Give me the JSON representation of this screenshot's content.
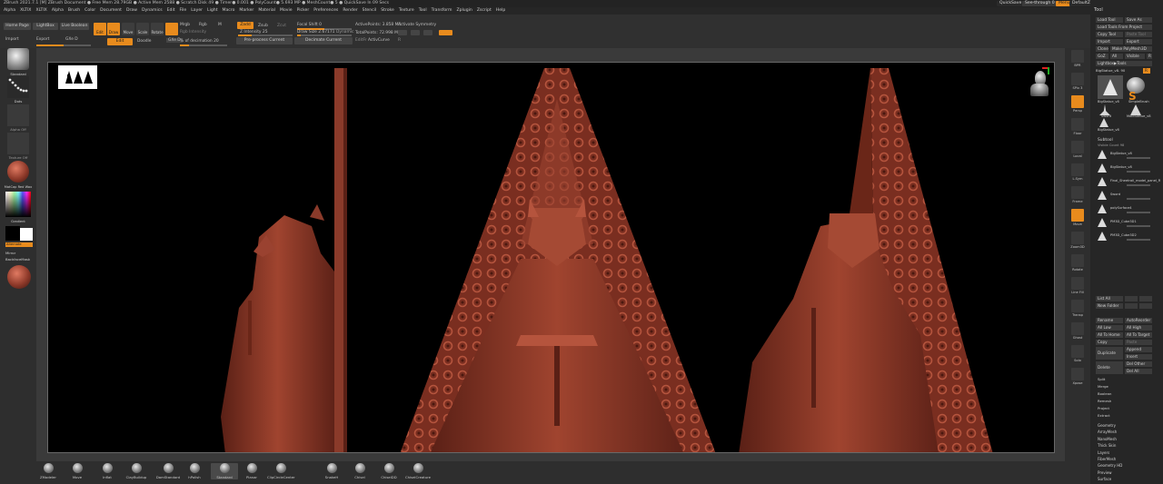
{
  "title_bar": {
    "text": "ZBrush 2021.7.1 [M]   ZBrush Document   ● Free Mem 28.79GB ● Active Mem 2588 ● Scratch Disk 49 ● Timer● 0.001 ● PolyCount● 5.693 MP ● MeshCount● 5 ● QuickSave In 09 Secs",
    "quicksave": "QuickSave",
    "see_through": "See-through 0",
    "menus": "Menus",
    "script": "DefaultZScript"
  },
  "menu_items": [
    "Alpha",
    "Brush",
    "Color",
    "Document",
    "Draw",
    "Dynamics",
    "Edit",
    "File",
    "Layer",
    "Light",
    "Macro",
    "Marker",
    "Material",
    "Movie",
    "Picker",
    "Preferences",
    "Render",
    "Stencil",
    "Stroke",
    "Texture",
    "Tool",
    "Transform",
    "Zplugin",
    "Zscript",
    "Help"
  ],
  "menu_prefix": [
    "Alpha",
    "XLTIX",
    "XLTIX"
  ],
  "shelf": {
    "home_page": "Home Page",
    "lightbox": "LightBox",
    "live_boolean": "Live Boolean",
    "import": "Import",
    "export": "Export",
    "gizmo": "GXe D",
    "edit": "Edit",
    "draw": "Draw",
    "move": "Move",
    "scale": "Scale",
    "rotate": "Rotate",
    "doodle": "Doodle",
    "mrgb": "Mrgb",
    "rgb": "Rgb",
    "m": "M",
    "rgb_intensity": "Rgb Intensity",
    "zadd": "Zadd",
    "zsub": "Zsub",
    "zcut": "Zcut",
    "z_intensity": "Z Intensity 25",
    "of_decimation": "% of decimation 20",
    "preprocess": "Pre-process Current",
    "decimate": "Decimate Current",
    "focal_shift": "Focal Shift 0",
    "draw_size": "Draw Size 2.67171",
    "dynamic": "Dynamic",
    "active_points": "ActivePoints: 3.858 Mil",
    "total_points": "TotalPoints: 72.998 Mil",
    "edit_frame": "EditFr",
    "active_curve": "ActivCurve",
    "r": "R",
    "symmetry": "Activate Symmetry",
    "tool": "Tool"
  },
  "left_panel": {
    "brush": "Standard",
    "stroke": "Dots",
    "alpha": "Alpha Off",
    "texture": "Texture Off",
    "material": "MatCap Red Wax",
    "gradient": "Gradient",
    "switch": "SwitchColor",
    "alternate": "Alternate",
    "mirror": "Mirror",
    "backface": "BackfaceMask"
  },
  "right_shelf": [
    "BPR",
    "SPix 3",
    "Persp",
    "Floor",
    "Local",
    "L.Sym",
    "Frame",
    "Move",
    "Zoom3D",
    "Rotate",
    "Line Fill",
    "Transp",
    "Ghost",
    "Solo",
    "Xpose"
  ],
  "bottom_brushes": [
    "ZModeler",
    "Move",
    "Inflat",
    "ClayBuildup",
    "DamStandard",
    "hPolish",
    "Standard",
    "Planar",
    "ClipCircleCenter",
    "SnakeH",
    "Chisel",
    "ChiselDD",
    "ChiselCreature"
  ],
  "tool_panel": {
    "title": "Tool",
    "load_tool": "Load Tool",
    "save_as": "Save As",
    "load_from_project": "Load Tools From Project",
    "copy_tool": "Copy Tool",
    "paste_tool": "Paste Tool",
    "import": "Import",
    "export": "Export",
    "clone": "Clone",
    "make_polymesh": "Make PolyMesh3D",
    "goz": "GoZ",
    "all": "All",
    "visible": "Visible",
    "r": "R",
    "lightbox_tools": "Lightbox▶Tools",
    "current_tool": "BigStatue_v8. 90",
    "thumbs": [
      "BigStatue_v8",
      "SimpleBrush",
      "Sword",
      "MoldStatue_v8",
      "BigStatue_v8"
    ],
    "subtool": "Subtool",
    "subtool_count": "Visible Count 98",
    "subtools": [
      "BigStatue_v8",
      "BigStatue_v8",
      "Final_Sheetrail_model_panel_R",
      "Sword",
      "polySurface4",
      "PM3D_Cube3D1",
      "PM3D_Cube3D2"
    ],
    "list_all": "List All",
    "new_folder": "New Folder",
    "rename": "Rename",
    "autoreorder": "AutoReorder",
    "all_low": "All Low",
    "all_high": "All High",
    "all_to_home": "All To Home",
    "all_to_target": "All To Target",
    "copy": "Copy",
    "paste": "Paste",
    "duplicate": "Duplicate",
    "append": "Append",
    "insert": "Insert",
    "delete": "Delete",
    "del_other": "Del Other",
    "del_all": "Del All",
    "split": "Split",
    "merge": "Merge",
    "boolean": "Boolean",
    "remesh": "Remesh",
    "project": "Project",
    "extract": "Extract",
    "sections": [
      "Geometry",
      "ArrayMesh",
      "NanoMesh",
      "Thick Skin",
      "Layers",
      "FiberMesh",
      "Geometry HD",
      "Preview",
      "Surface"
    ]
  },
  "colors": {
    "accent": "#e88b1d",
    "wax": "#8f3a2a",
    "bg": "#2b2b2b"
  }
}
